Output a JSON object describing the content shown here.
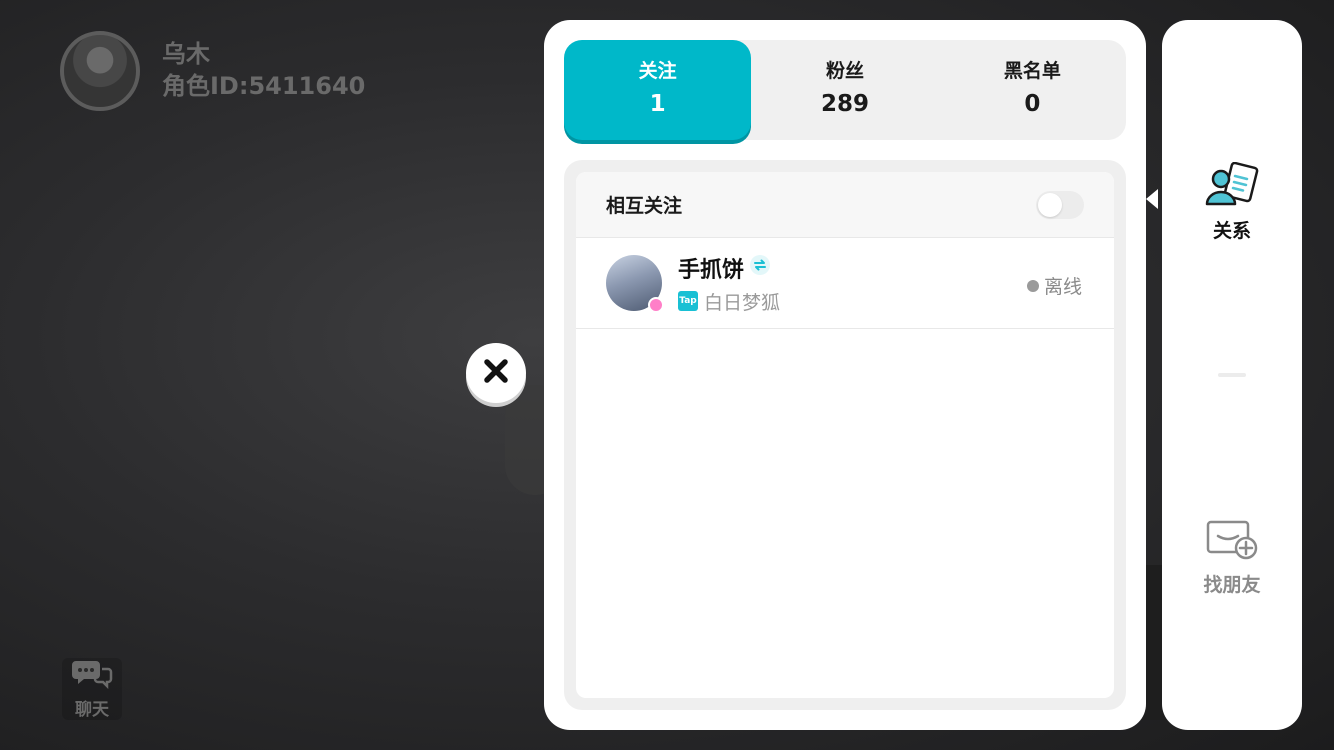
{
  "profile": {
    "name": "乌木",
    "role_id": "角色ID:5411640"
  },
  "chat_button": {
    "label": "聊天"
  },
  "tabs": [
    {
      "label": "关注",
      "count": "1",
      "active": true
    },
    {
      "label": "粉丝",
      "count": "289",
      "active": false
    },
    {
      "label": "黑名单",
      "count": "0",
      "active": false
    }
  ],
  "mutual_filter": {
    "label": "相互关注",
    "enabled": false
  },
  "friends": [
    {
      "name": "手抓饼",
      "platform_badge": "Tap",
      "platform_name": "白日梦狐",
      "status": "离线"
    }
  ],
  "side_nav": {
    "relation_label": "关系",
    "find_friends_label": "找朋友"
  },
  "colors": {
    "accent": "#00b8c9",
    "accent_shadow": "#0095a3",
    "relation_icon": "#4fc3d4",
    "offline_dot": "#9a9a9a"
  },
  "icons": {
    "close": "close-icon",
    "chat": "chat-bubbles-icon",
    "relation": "contacts-card-icon",
    "find_friends": "envelope-add-icon",
    "mutual": "mutual-follow-icon"
  }
}
